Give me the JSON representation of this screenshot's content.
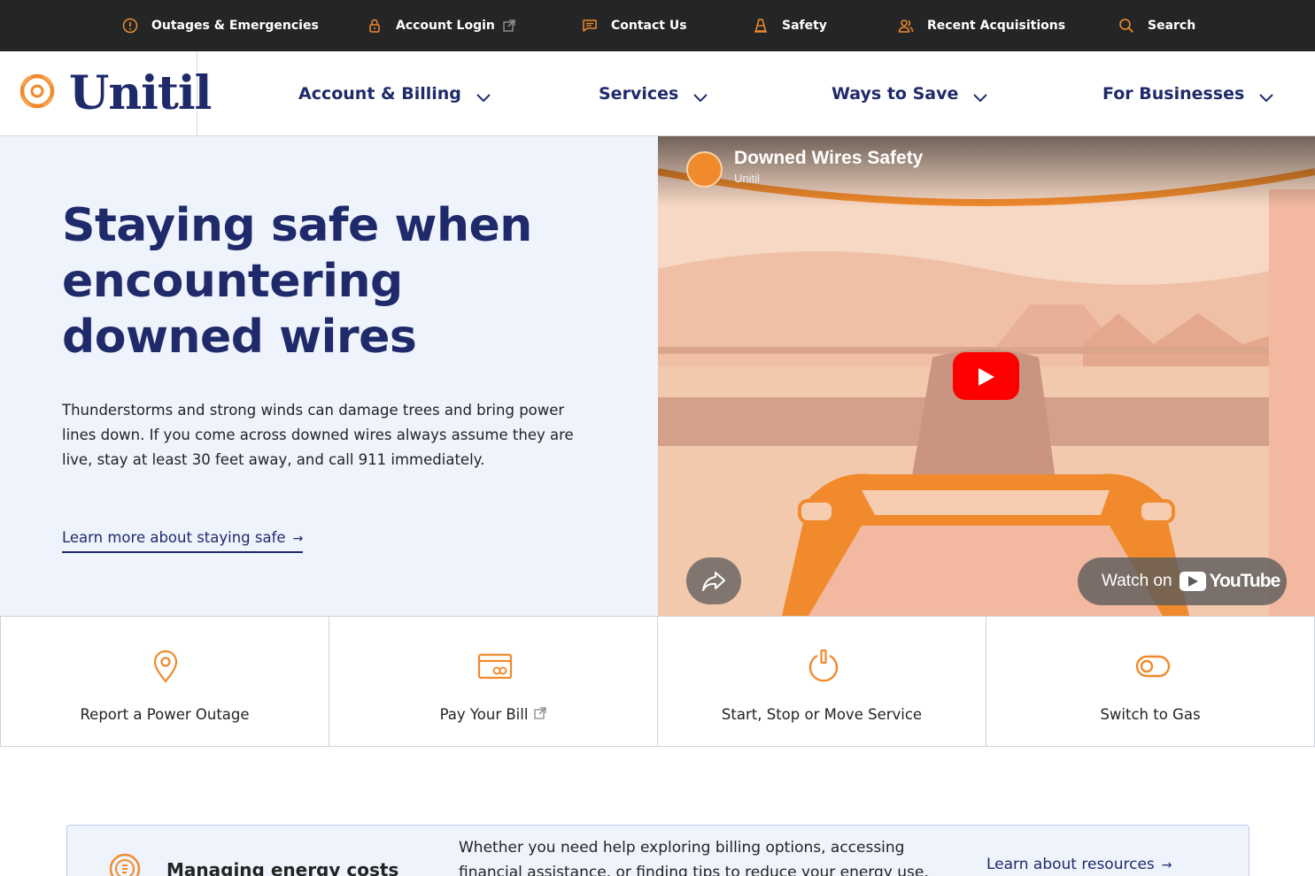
{
  "brand": {
    "name": "Unitil",
    "accent_color": "#f08a2c",
    "navy_color": "#1f2a6b"
  },
  "utility_nav": [
    {
      "label": "Outages & Emergencies",
      "icon": "alert-circle-icon"
    },
    {
      "label": "Account Login",
      "icon": "lock-icon",
      "external": true
    },
    {
      "label": "Contact Us",
      "icon": "chat-icon"
    },
    {
      "label": "Safety",
      "icon": "cone-icon"
    },
    {
      "label": "Recent Acquisitions",
      "icon": "users-icon"
    },
    {
      "label": "Search",
      "icon": "search-icon"
    }
  ],
  "main_nav": [
    {
      "label": "Account & Billing"
    },
    {
      "label": "Services"
    },
    {
      "label": "Ways to Save"
    },
    {
      "label": "For Businesses"
    }
  ],
  "hero": {
    "title": "Staying safe when encountering downed wires",
    "body": "Thunderstorms and strong winds can damage trees and bring power lines down. If you come across downed wires always assume they are live, stay at least 30 feet away, and call 911 immediately.",
    "link": "Learn more about staying safe",
    "link_arrow": "→"
  },
  "video": {
    "title": "Downed Wires Safety",
    "channel": "Unitil",
    "watch_label": "Watch on",
    "platform": "YouTube"
  },
  "quick_links": [
    {
      "label": "Report a Power Outage",
      "icon": "map-pin-icon"
    },
    {
      "label": "Pay Your Bill",
      "icon": "bill-card-icon",
      "external": true
    },
    {
      "label": "Start, Stop or Move Service",
      "icon": "power-icon"
    },
    {
      "label": "Switch to Gas",
      "icon": "toggle-icon"
    }
  ],
  "resource": {
    "title": "Managing energy costs",
    "body": "Whether you need help exploring billing options, accessing financial assistance, or finding tips to reduce your energy use, we're here to help.",
    "link": "Learn about resources",
    "link_arrow": "→",
    "icon": "savings-icon"
  }
}
